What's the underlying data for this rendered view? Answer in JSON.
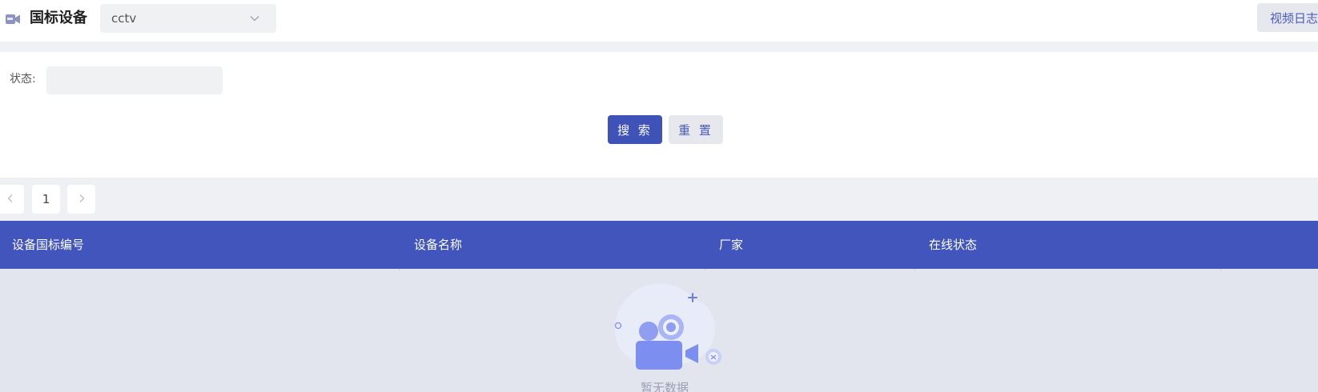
{
  "header": {
    "title": "国标设备",
    "icon": "camera-icon",
    "select": {
      "value": "cctv",
      "icon": "chevron-down-icon"
    },
    "log_button": "视频日志"
  },
  "filter": {
    "status_label": "状态:",
    "status_value": "",
    "search_label": "搜 索",
    "reset_label": "重 置"
  },
  "pagination": {
    "prev_icon": "chevron-left-icon",
    "current_page": "1",
    "next_icon": "chevron-right-icon"
  },
  "table": {
    "columns": [
      "设备国标编号",
      "设备名称",
      "厂家",
      "在线状态"
    ],
    "rows": [],
    "empty_text": "暂无数据"
  },
  "colors": {
    "primary": "#4155bc",
    "header_bg": "#ffffff",
    "band_bg": "#eff0f4",
    "table_body_bg": "#e3e5ee"
  }
}
